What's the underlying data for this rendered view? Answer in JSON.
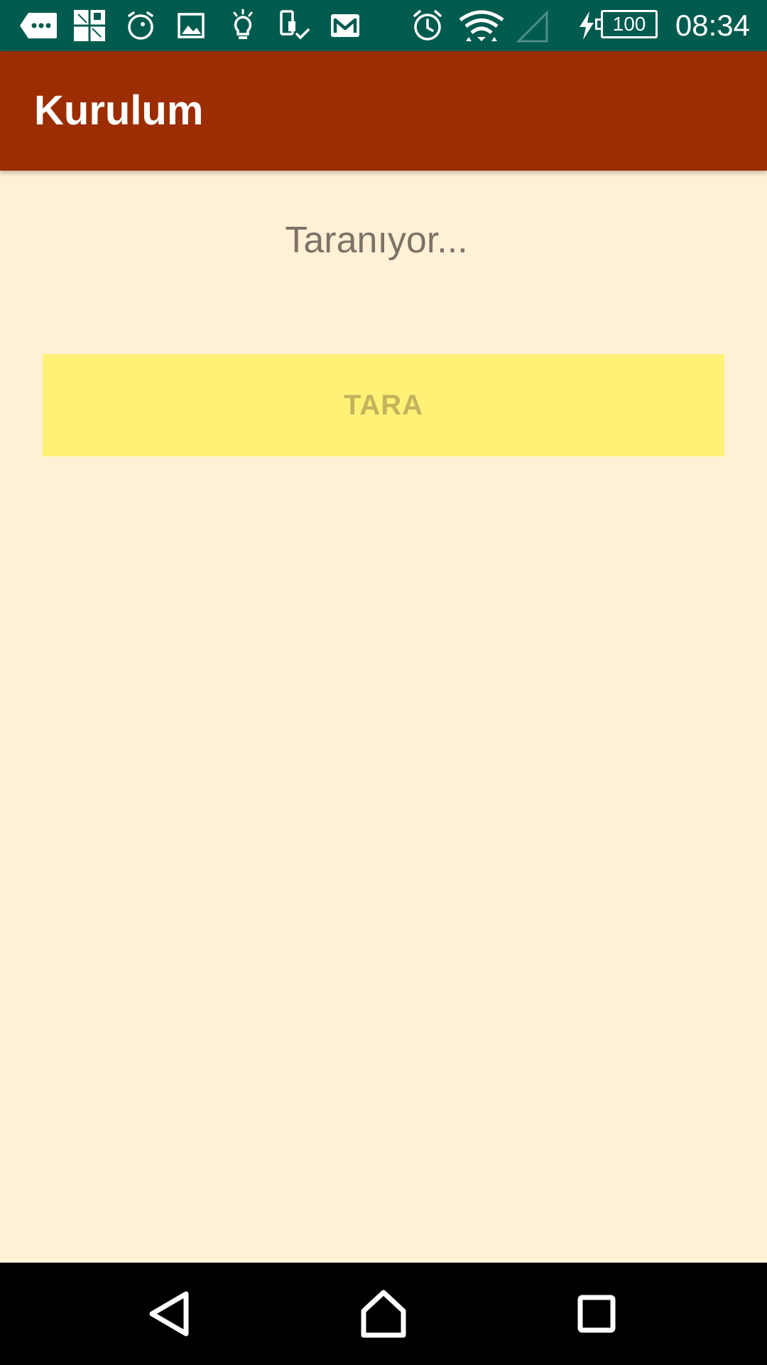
{
  "status_bar": {
    "time": "08:34",
    "battery_level": "100",
    "icons": [
      "message-icon",
      "puzzle-icon",
      "alarm-icon",
      "image-icon",
      "bulb-icon",
      "sim-icon",
      "gmail-icon",
      "alarm-clock-icon",
      "wifi-icon",
      "signal-icon",
      "charging-icon",
      "battery-icon"
    ]
  },
  "app_bar": {
    "title": "Kurulum"
  },
  "main": {
    "scan_status": "Taranıyor...",
    "scan_button_label": "TARA"
  },
  "colors": {
    "status_bar": "#005b4f",
    "app_bar": "#9b2d00",
    "background": "#fff1d6",
    "button": "#fff176",
    "button_text": "#c2b35c",
    "status_text": "#7d7266"
  },
  "nav_bar": {
    "icons": [
      "back-icon",
      "home-icon",
      "recents-icon"
    ]
  }
}
